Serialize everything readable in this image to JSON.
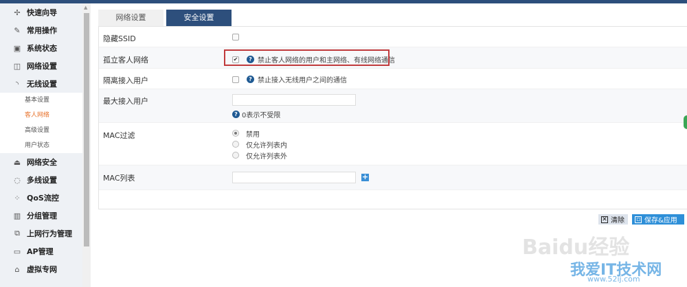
{
  "sidebar": {
    "items": [
      {
        "label": "快速向导",
        "icon": "signpost-icon",
        "glyph": "✢"
      },
      {
        "label": "常用操作",
        "icon": "wrench-icon",
        "glyph": "✎"
      },
      {
        "label": "系统状态",
        "icon": "monitor-icon",
        "glyph": "▣"
      },
      {
        "label": "网络设置",
        "icon": "network-icon",
        "glyph": "◫"
      },
      {
        "label": "无线设置",
        "icon": "wifi-icon",
        "glyph": "◝"
      }
    ],
    "subitems": [
      {
        "label": "基本设置",
        "active": false
      },
      {
        "label": "客人网络",
        "active": true
      },
      {
        "label": "高级设置",
        "active": false
      },
      {
        "label": "用户状态",
        "active": false
      }
    ],
    "items2": [
      {
        "label": "网络安全",
        "icon": "security-icon",
        "glyph": "⏏"
      },
      {
        "label": "多线设置",
        "icon": "multiline-icon",
        "glyph": "◌"
      },
      {
        "label": "QoS流控",
        "icon": "qos-icon",
        "glyph": "⁘"
      },
      {
        "label": "分组管理",
        "icon": "group-icon",
        "glyph": "▥"
      },
      {
        "label": "上网行为管理",
        "icon": "behavior-icon",
        "glyph": "⧉"
      },
      {
        "label": "AP管理",
        "icon": "folder-icon",
        "glyph": "▭"
      },
      {
        "label": "虚拟专网",
        "icon": "vpn-icon",
        "glyph": "⌂"
      }
    ]
  },
  "tabs": [
    {
      "label": "网络设置",
      "active": false
    },
    {
      "label": "安全设置",
      "active": true
    }
  ],
  "form": {
    "hide_ssid": {
      "label": "隐藏SSID",
      "checked": false
    },
    "isolate_guest": {
      "label": "孤立客人网络",
      "checked": true,
      "hint": "禁止客人网络的用户和主网络、有线网络通信"
    },
    "isolate_users": {
      "label": "隔离接入用户",
      "checked": false,
      "hint": "禁止接入无线用户之间的通信"
    },
    "max_users": {
      "label": "最大接入用户",
      "value": "",
      "hint": "0表示不受限"
    },
    "mac_filter": {
      "label": "MAC过滤",
      "options": [
        "禁用",
        "仅允许列表内",
        "仅允许列表外"
      ],
      "selected": "禁用"
    },
    "mac_list": {
      "label": "MAC列表",
      "value": ""
    }
  },
  "buttons": {
    "clear": "清除",
    "save": "保存&应用"
  },
  "watermark": {
    "line1": "Baidu经验",
    "line2": "我爱IT技术网",
    "line3": "www.52ij.com"
  },
  "colors": {
    "accent": "#2d4f7c",
    "active_sub": "#e8742e",
    "save": "#2e8fd8",
    "highlight": "#c0393b"
  }
}
